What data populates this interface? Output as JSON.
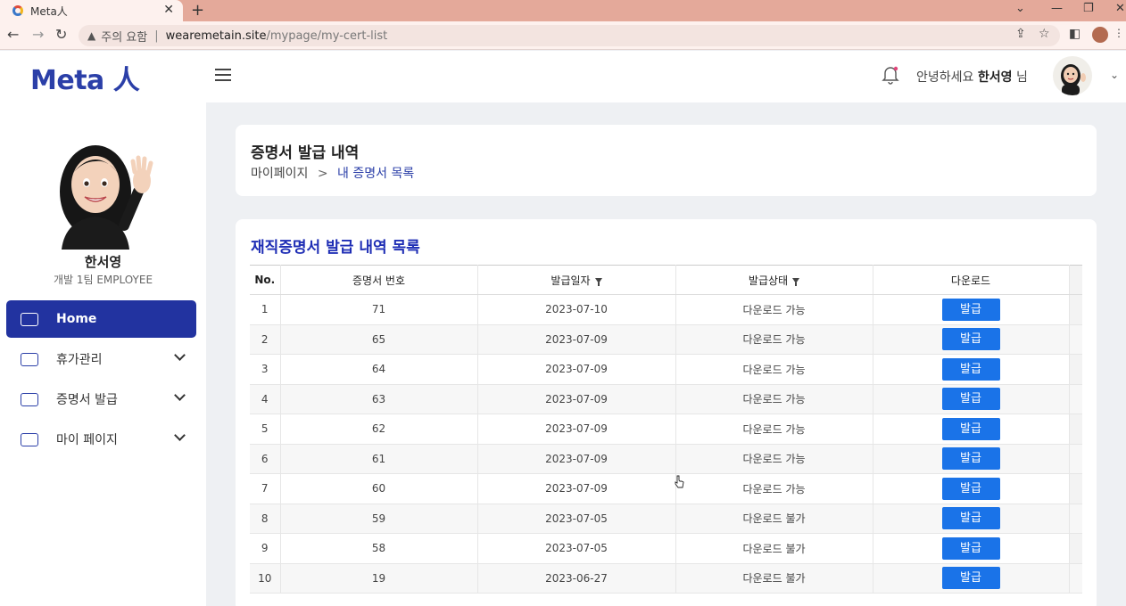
{
  "browser": {
    "tab_title": "Meta人",
    "url_warning": "주의 요함",
    "url_host": "wearemetain.site",
    "url_path": "/mypage/my-cert-list"
  },
  "header": {
    "logo": "Meta 人",
    "greeting_prefix": "안녕하세요",
    "user_name": "한서영",
    "greeting_suffix": "님"
  },
  "sidebar": {
    "user_name": "한서영",
    "user_role": "개발 1팀 EMPLOYEE",
    "items": [
      {
        "label": "Home"
      },
      {
        "label": "휴가관리"
      },
      {
        "label": "증명서 발급"
      },
      {
        "label": "마이 페이지"
      }
    ]
  },
  "page": {
    "title": "증명서 발급 내역",
    "breadcrumb_root": "마이페이지",
    "breadcrumb_sep": ">",
    "breadcrumb_current": "내 증명서 목록"
  },
  "table": {
    "title": "재직증명서 발급 내역 목록",
    "headers": {
      "no": "No.",
      "serial": "증명서 번호",
      "date": "발급일자",
      "status": "발급상태",
      "download": "다운로드"
    },
    "button_label": "발급",
    "rows": [
      {
        "no": "1",
        "serial": "71",
        "date": "2023-07-10",
        "status": "다운로드 가능"
      },
      {
        "no": "2",
        "serial": "65",
        "date": "2023-07-09",
        "status": "다운로드 가능"
      },
      {
        "no": "3",
        "serial": "64",
        "date": "2023-07-09",
        "status": "다운로드 가능"
      },
      {
        "no": "4",
        "serial": "63",
        "date": "2023-07-09",
        "status": "다운로드 가능"
      },
      {
        "no": "5",
        "serial": "62",
        "date": "2023-07-09",
        "status": "다운로드 가능"
      },
      {
        "no": "6",
        "serial": "61",
        "date": "2023-07-09",
        "status": "다운로드 가능"
      },
      {
        "no": "7",
        "serial": "60",
        "date": "2023-07-09",
        "status": "다운로드 가능"
      },
      {
        "no": "8",
        "serial": "59",
        "date": "2023-07-05",
        "status": "다운로드 불가"
      },
      {
        "no": "9",
        "serial": "58",
        "date": "2023-07-05",
        "status": "다운로드 불가"
      },
      {
        "no": "10",
        "serial": "19",
        "date": "2023-06-27",
        "status": "다운로드 불가"
      }
    ]
  },
  "colors": {
    "brand": "#2b3fa8",
    "active_menu": "#2233a0",
    "list_title": "#1f2eb5",
    "button": "#1a73e8"
  }
}
